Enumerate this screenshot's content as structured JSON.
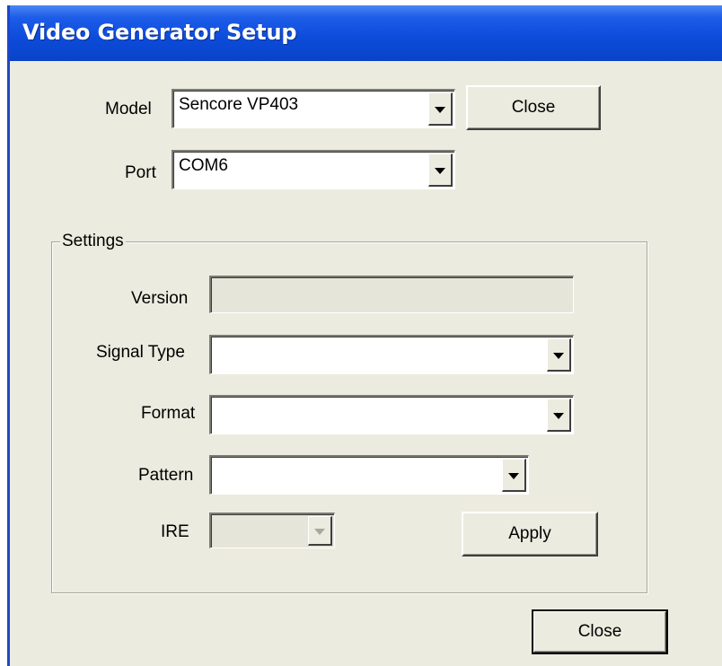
{
  "window": {
    "title": "Video Generator Setup"
  },
  "model": {
    "label": "Model",
    "value": "Sencore VP403"
  },
  "port": {
    "label": "Port",
    "value": "COM6"
  },
  "settings": {
    "group_label": "Settings",
    "version": {
      "label": "Version",
      "value": ""
    },
    "signal_type": {
      "label": "Signal Type",
      "value": ""
    },
    "format": {
      "label": "Format",
      "value": ""
    },
    "pattern": {
      "label": "Pattern",
      "value": ""
    },
    "ire": {
      "label": "IRE",
      "value": "",
      "enabled": false
    },
    "apply_label": "Apply"
  },
  "buttons": {
    "close_top": "Close",
    "close_bottom": "Close"
  },
  "icons": {
    "dropdown": "chevron-down-icon"
  },
  "colors": {
    "titlebar": "#0b4ad8",
    "window_bg": "#ecebdf"
  }
}
